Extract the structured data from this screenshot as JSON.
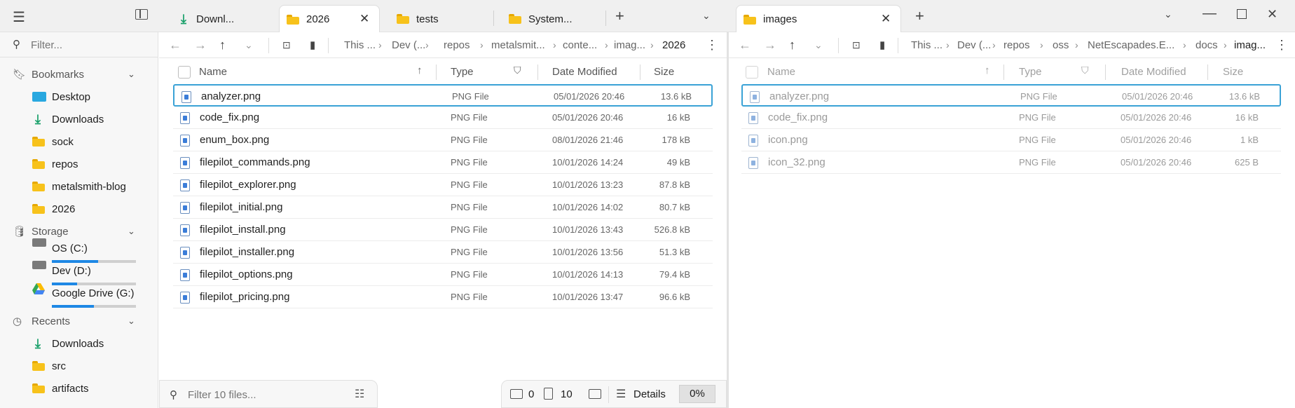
{
  "tabs": [
    {
      "label": "Downl...",
      "icon": "download-icon"
    },
    {
      "label": "2026",
      "icon": "folder-icon",
      "active": true
    },
    {
      "label": "tests",
      "icon": "folder-icon"
    },
    {
      "label": "System...",
      "icon": "folder-icon"
    }
  ],
  "right_tab": {
    "label": "images"
  },
  "sidebar": {
    "filter_placeholder": "Filter...",
    "bookmarks_title": "Bookmarks",
    "bookmarks": [
      {
        "label": "Desktop",
        "icon": "desktop-icon"
      },
      {
        "label": "Downloads",
        "icon": "download-icon"
      },
      {
        "label": "sock",
        "icon": "folder-icon"
      },
      {
        "label": "repos",
        "icon": "folder-icon"
      },
      {
        "label": "metalsmith-blog",
        "icon": "folder-icon"
      },
      {
        "label": "2026",
        "icon": "folder-icon"
      }
    ],
    "storage_title": "Storage",
    "storage": [
      {
        "label": "OS (C:)",
        "used_fraction": 0.55
      },
      {
        "label": "Dev (D:)",
        "used_fraction": 0.3
      },
      {
        "label": "Google Drive (G:)",
        "used_fraction": 0.5
      }
    ],
    "recents_title": "Recents",
    "recents": [
      {
        "label": "Downloads",
        "icon": "download-icon"
      },
      {
        "label": "src",
        "icon": "folder-icon"
      },
      {
        "label": "artifacts",
        "icon": "folder-icon"
      }
    ]
  },
  "left_pane": {
    "breadcrumbs": [
      "This ...",
      "Dev (...",
      "repos",
      "metalsmit...",
      "conte...",
      "imag...",
      "2026"
    ],
    "columns": {
      "name": "Name",
      "type": "Type",
      "date": "Date Modified",
      "size": "Size"
    },
    "files": [
      {
        "name": "analyzer.png",
        "type": "PNG File",
        "date": "05/01/2026 20:46",
        "size": "13.6 kB"
      },
      {
        "name": "code_fix.png",
        "type": "PNG File",
        "date": "05/01/2026 20:46",
        "size": "16 kB"
      },
      {
        "name": "enum_box.png",
        "type": "PNG File",
        "date": "08/01/2026 21:46",
        "size": "178 kB"
      },
      {
        "name": "filepilot_commands.png",
        "type": "PNG File",
        "date": "10/01/2026 14:24",
        "size": "49 kB"
      },
      {
        "name": "filepilot_explorer.png",
        "type": "PNG File",
        "date": "10/01/2026 13:23",
        "size": "87.8 kB"
      },
      {
        "name": "filepilot_initial.png",
        "type": "PNG File",
        "date": "10/01/2026 14:02",
        "size": "80.7 kB"
      },
      {
        "name": "filepilot_install.png",
        "type": "PNG File",
        "date": "10/01/2026 13:43",
        "size": "526.8 kB"
      },
      {
        "name": "filepilot_installer.png",
        "type": "PNG File",
        "date": "10/01/2026 13:56",
        "size": "51.3 kB"
      },
      {
        "name": "filepilot_options.png",
        "type": "PNG File",
        "date": "10/01/2026 14:13",
        "size": "79.4 kB"
      },
      {
        "name": "filepilot_pricing.png",
        "type": "PNG File",
        "date": "10/01/2026 13:47",
        "size": "96.6 kB"
      }
    ],
    "filter_placeholder": "Filter 10 files...",
    "status": {
      "folders": "0",
      "files": "10",
      "view": "Details",
      "progress": "0%"
    }
  },
  "right_pane": {
    "breadcrumbs": [
      "This ...",
      "Dev (...",
      "repos",
      "oss",
      "NetEscapades.E...",
      "docs",
      "imag..."
    ],
    "columns": {
      "name": "Name",
      "type": "Type",
      "date": "Date Modified",
      "size": "Size"
    },
    "files": [
      {
        "name": "analyzer.png",
        "type": "PNG File",
        "date": "05/01/2026 20:46",
        "size": "13.6 kB"
      },
      {
        "name": "code_fix.png",
        "type": "PNG File",
        "date": "05/01/2026 20:46",
        "size": "16 kB"
      },
      {
        "name": "icon.png",
        "type": "PNG File",
        "date": "05/01/2026 20:46",
        "size": "1 kB"
      },
      {
        "name": "icon_32.png",
        "type": "PNG File",
        "date": "05/01/2026 20:46",
        "size": "625 B"
      }
    ]
  }
}
